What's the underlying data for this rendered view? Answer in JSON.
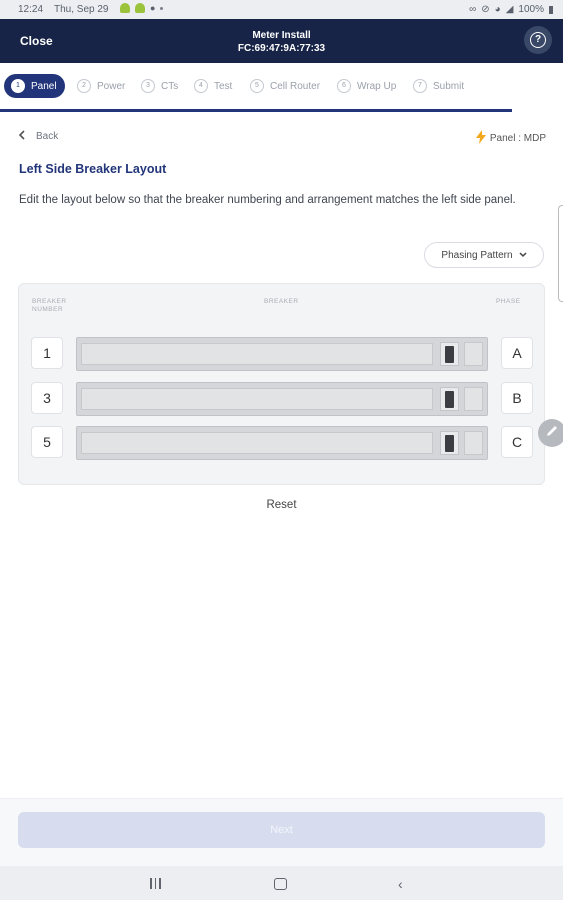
{
  "status_bar": {
    "time": "12:24",
    "date": "Thu, Sep 29",
    "battery": "100%"
  },
  "app_bar": {
    "close_label": "Close",
    "title": "Meter Install",
    "subtitle": "FC:69:47:9A:77:33",
    "help_icon": "question-circle-icon"
  },
  "steps": [
    {
      "num": "1",
      "label": "Panel",
      "active": true
    },
    {
      "num": "2",
      "label": "Power",
      "active": false
    },
    {
      "num": "3",
      "label": "CTs",
      "active": false
    },
    {
      "num": "4",
      "label": "Test",
      "active": false
    },
    {
      "num": "5",
      "label": "Cell Router",
      "active": false
    },
    {
      "num": "6",
      "label": "Wrap Up",
      "active": false
    },
    {
      "num": "7",
      "label": "Submit",
      "active": false
    }
  ],
  "nav": {
    "back_label": "Back",
    "panel_info": "Panel : MDP"
  },
  "section": {
    "title": "Left Side Breaker Layout",
    "description": "Edit the layout below so that the breaker numbering and arrangement matches the left side panel."
  },
  "phasing_button": {
    "label": "Phasing Pattern"
  },
  "table_headers": {
    "number": "BREAKER NUMBER",
    "breaker": "BREAKER",
    "phase": "PHASE"
  },
  "breakers": [
    {
      "number": "1",
      "phase": "A"
    },
    {
      "number": "3",
      "phase": "B"
    },
    {
      "number": "5",
      "phase": "C"
    }
  ],
  "reset_label": "Reset",
  "submit_label": "Next",
  "colors": {
    "primary": "#22357a",
    "app_bar": "#172447",
    "accent": "#f2a81d",
    "disabled_button": "#d7ddee"
  }
}
